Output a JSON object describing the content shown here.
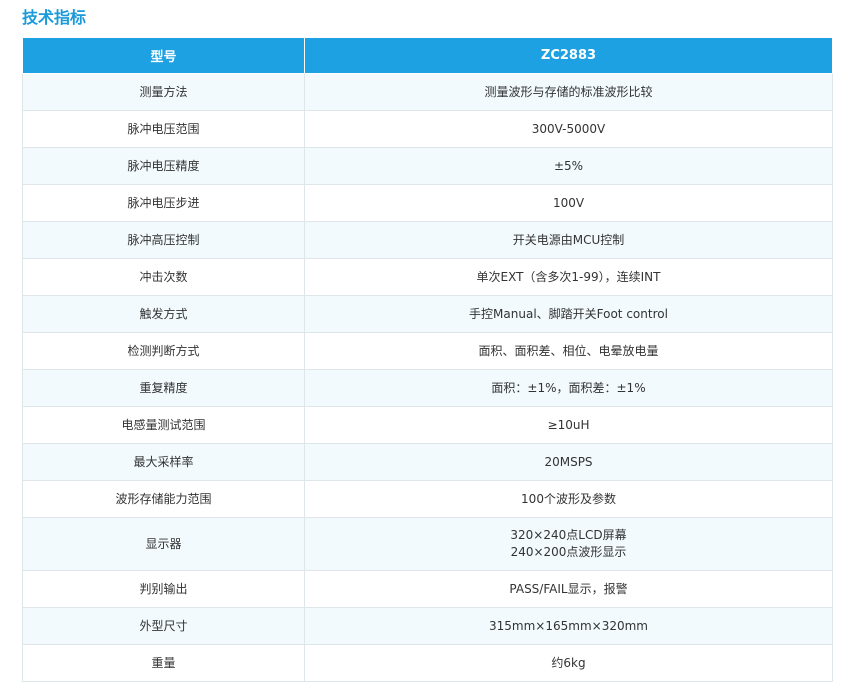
{
  "section_title": "技术指标",
  "table": {
    "headers": [
      "型号",
      "ZC2883"
    ],
    "rows": [
      {
        "param": "测量方法",
        "value": [
          "测量波形与存储的标准波形比较"
        ]
      },
      {
        "param": "脉冲电压范围",
        "value": [
          "300V-5000V"
        ]
      },
      {
        "param": "脉冲电压精度",
        "value": [
          "±5%"
        ]
      },
      {
        "param": "脉冲电压步进",
        "value": [
          "100V"
        ]
      },
      {
        "param": "脉冲高压控制",
        "value": [
          "开关电源由MCU控制"
        ]
      },
      {
        "param": "冲击次数",
        "value": [
          "单次EXT（含多次1-99），连续INT"
        ]
      },
      {
        "param": "触发方式",
        "value": [
          "手控Manual、脚踏开关Foot control"
        ]
      },
      {
        "param": "检测判断方式",
        "value": [
          "面积、面积差、相位、电晕放电量"
        ]
      },
      {
        "param": "重复精度",
        "value": [
          "面积：±1%，面积差：±1%"
        ]
      },
      {
        "param": "电感量测试范围",
        "value": [
          "≥10uH"
        ]
      },
      {
        "param": "最大采样率",
        "value": [
          "20MSPS"
        ]
      },
      {
        "param": "波形存储能力范围",
        "value": [
          "100个波形及参数"
        ]
      },
      {
        "param": "显示器",
        "value": [
          "320×240点LCD屏幕",
          "240×200点波形显示"
        ]
      },
      {
        "param": "判别输出",
        "value": [
          "PASS/FAIL显示，报警"
        ]
      },
      {
        "param": "外型尺寸",
        "value": [
          "315mm×165mm×320mm"
        ]
      },
      {
        "param": "重量",
        "value": [
          "约6kg"
        ]
      }
    ]
  }
}
